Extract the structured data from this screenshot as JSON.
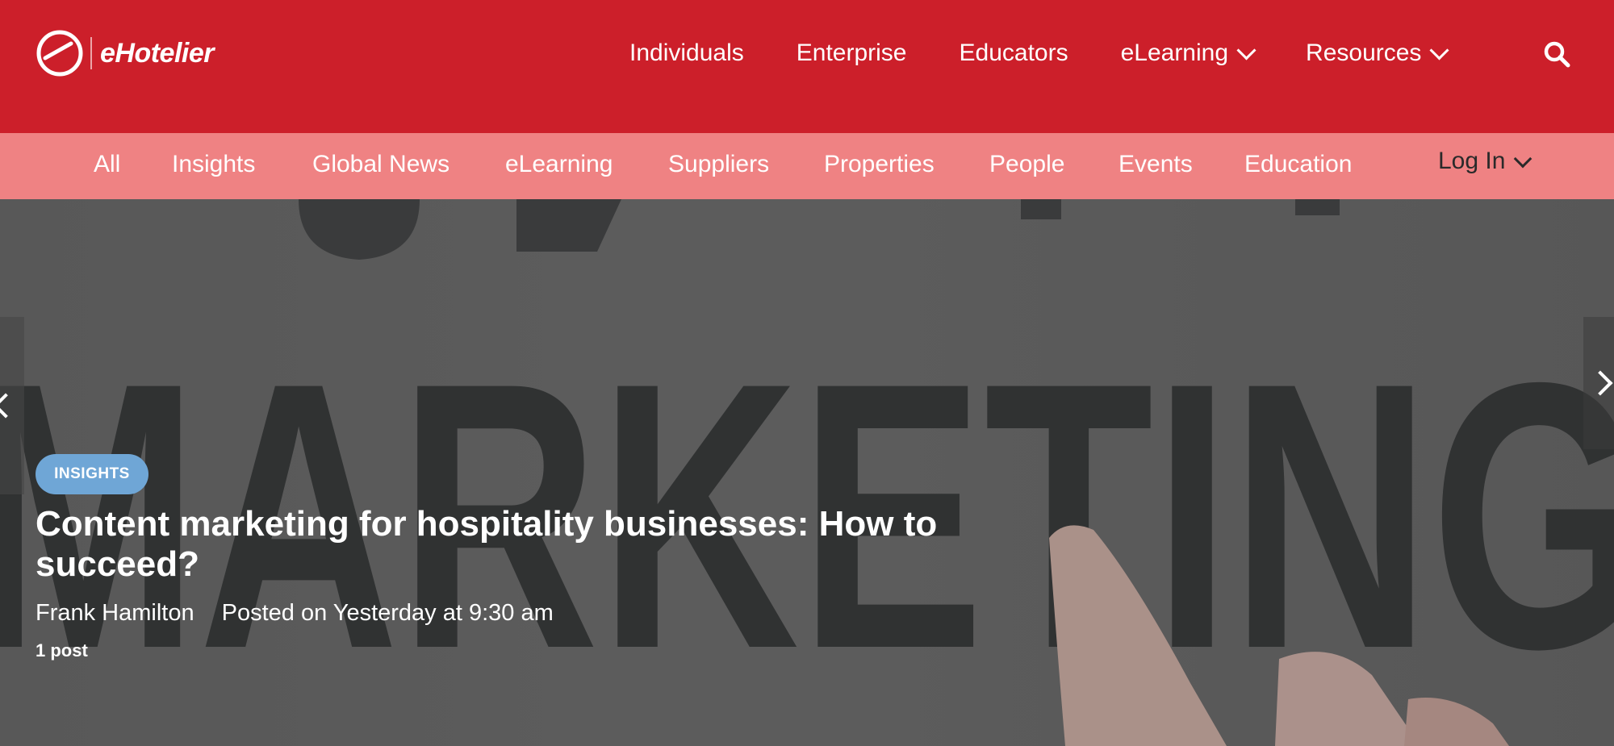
{
  "site": {
    "logo_text": "eHotelier"
  },
  "main_nav": {
    "items": [
      {
        "label": "Individuals"
      },
      {
        "label": "Enterprise"
      },
      {
        "label": "Educators"
      },
      {
        "label": "eLearning",
        "has_dropdown": true
      },
      {
        "label": "Resources",
        "has_dropdown": true
      }
    ],
    "search_icon": "search-icon"
  },
  "sub_nav": {
    "items": [
      {
        "label": "All"
      },
      {
        "label": "Insights"
      },
      {
        "label": "Global News"
      },
      {
        "label": "eLearning"
      },
      {
        "label": "Suppliers"
      },
      {
        "label": "Properties"
      },
      {
        "label": "People"
      },
      {
        "label": "Events"
      },
      {
        "label": "Education"
      }
    ],
    "login_label": "Log In"
  },
  "hero": {
    "category": "INSIGHTS",
    "title": "Content marketing for hospitality businesses: How to succeed?",
    "author": "Frank Hamilton",
    "posted": "Posted on Yesterday at 9:30 am",
    "post_count": "1 post",
    "image_text": "MARKETING"
  },
  "colors": {
    "topbar": "#cc1f2a",
    "subnav": "#ef8283",
    "badge": "#6fa6d6"
  }
}
